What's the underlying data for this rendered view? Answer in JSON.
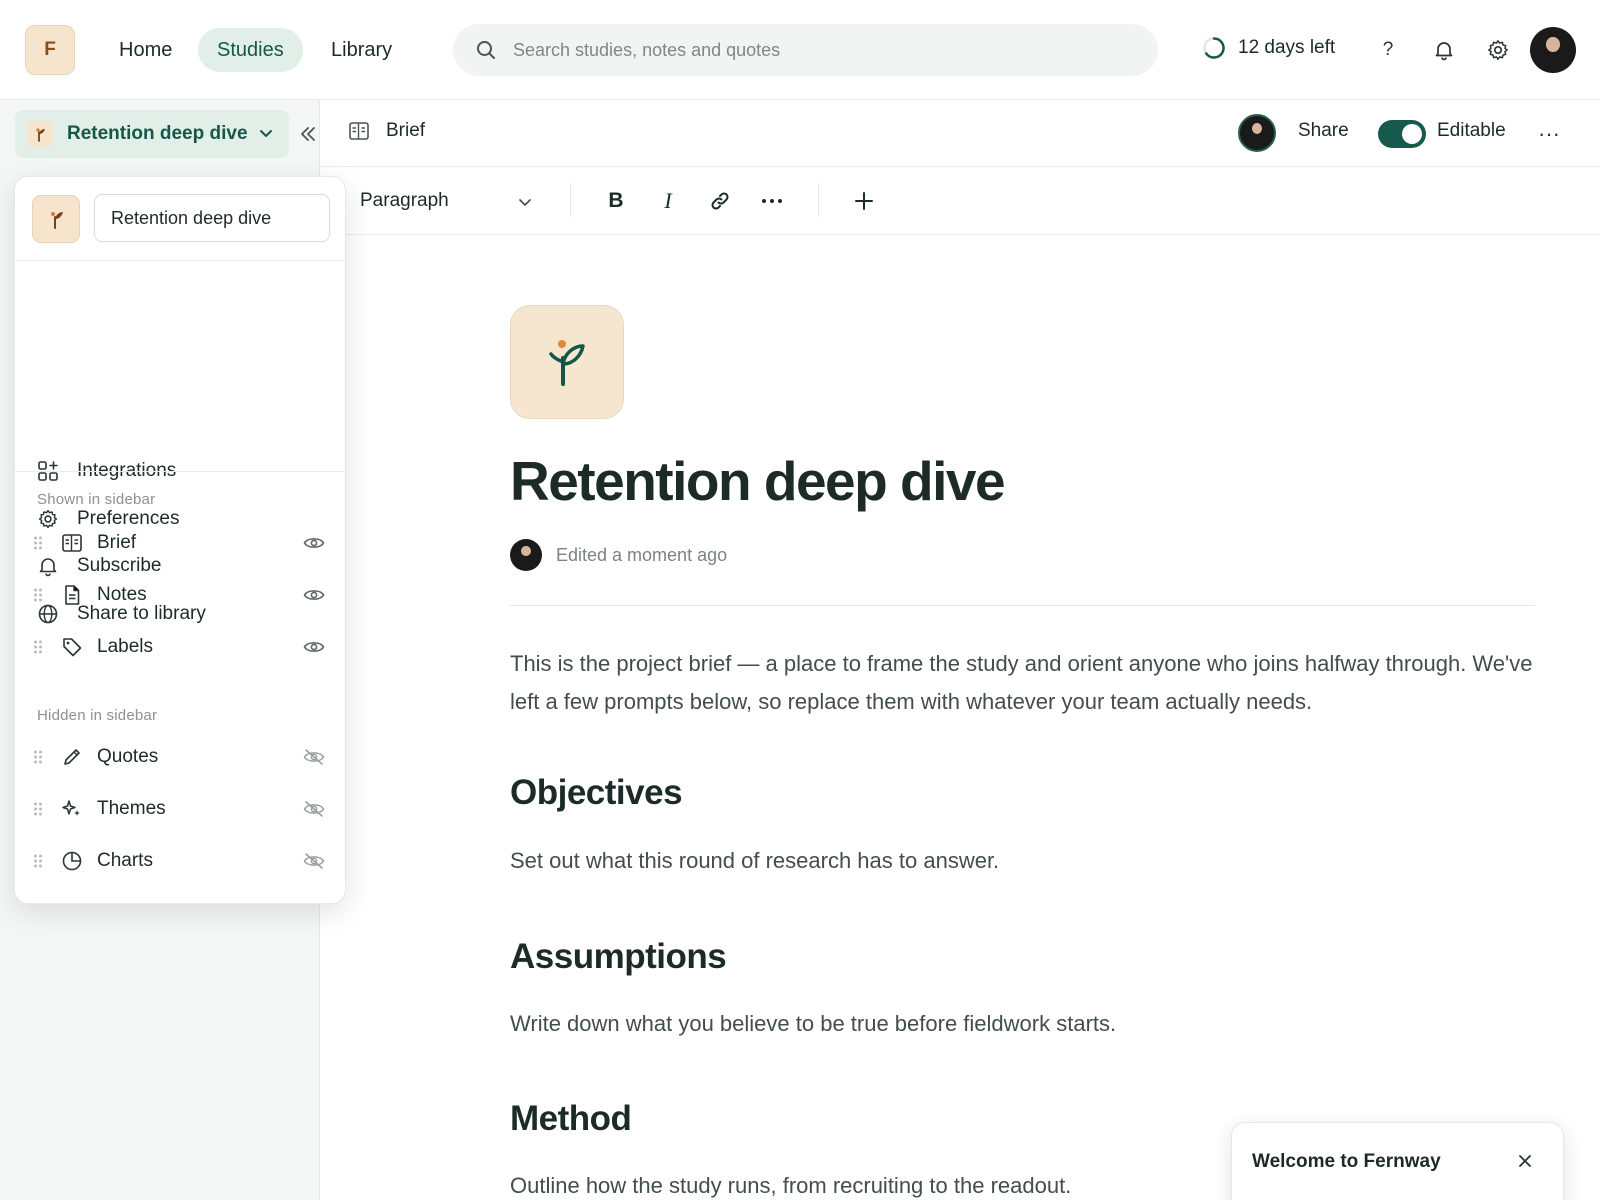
{
  "app": {
    "logo_letter": "F",
    "brand_color": "#17594b"
  },
  "nav": {
    "items": [
      {
        "label": "Home",
        "active": false
      },
      {
        "label": "Studies",
        "active": true
      },
      {
        "label": "Library",
        "active": false
      }
    ]
  },
  "search": {
    "placeholder": "Search studies, notes and quotes",
    "icon": "search-icon"
  },
  "trial": {
    "label": "12 days left"
  },
  "top_actions": {
    "help_label": "?",
    "icons": [
      "help-icon",
      "bell-icon",
      "gear-icon",
      "avatar"
    ]
  },
  "sidebar": {
    "study_name": "Retention deep dive"
  },
  "popover": {
    "name_value": "Retention deep dive",
    "menu": [
      {
        "label": "Integrations",
        "icon": "integrations-icon"
      },
      {
        "label": "Preferences",
        "icon": "gear-icon"
      },
      {
        "label": "Subscribe",
        "icon": "bell-icon"
      },
      {
        "label": "Share to library",
        "icon": "globe-icon"
      }
    ],
    "shown_heading": "Shown in sidebar",
    "shown": [
      {
        "label": "Brief",
        "icon": "brief-icon",
        "visible": true
      },
      {
        "label": "Notes",
        "icon": "notes-icon",
        "visible": true
      },
      {
        "label": "Labels",
        "icon": "tag-icon",
        "visible": true
      }
    ],
    "hidden_heading": "Hidden in sidebar",
    "hidden": [
      {
        "label": "Quotes",
        "icon": "pen-icon",
        "visible": false
      },
      {
        "label": "Themes",
        "icon": "sparkle-icon",
        "visible": false
      },
      {
        "label": "Charts",
        "icon": "pie-chart-icon",
        "visible": false
      }
    ]
  },
  "header": {
    "breadcrumb": "Brief",
    "share_label": "Share",
    "editable_label": "Editable",
    "editable_on": true,
    "more_label": "···"
  },
  "toolbar": {
    "block_type": "Paragraph",
    "bold_label": "B",
    "italic_label": "I"
  },
  "document": {
    "title": "Retention deep dive",
    "meta": "Edited a moment ago",
    "intro": "This is the project brief — a place to frame the study and orient anyone who joins halfway through. We've left a few prompts below, so replace them with whatever your team actually needs.",
    "sections": [
      {
        "heading": "Objectives",
        "body": "Set out what this round of research has to answer."
      },
      {
        "heading": "Assumptions",
        "body": "Write down what you believe to be true before fieldwork starts."
      },
      {
        "heading": "Method",
        "body": "Outline how the study runs, from recruiting to the readout."
      }
    ]
  },
  "welcome": {
    "title": "Welcome to Fernway"
  }
}
